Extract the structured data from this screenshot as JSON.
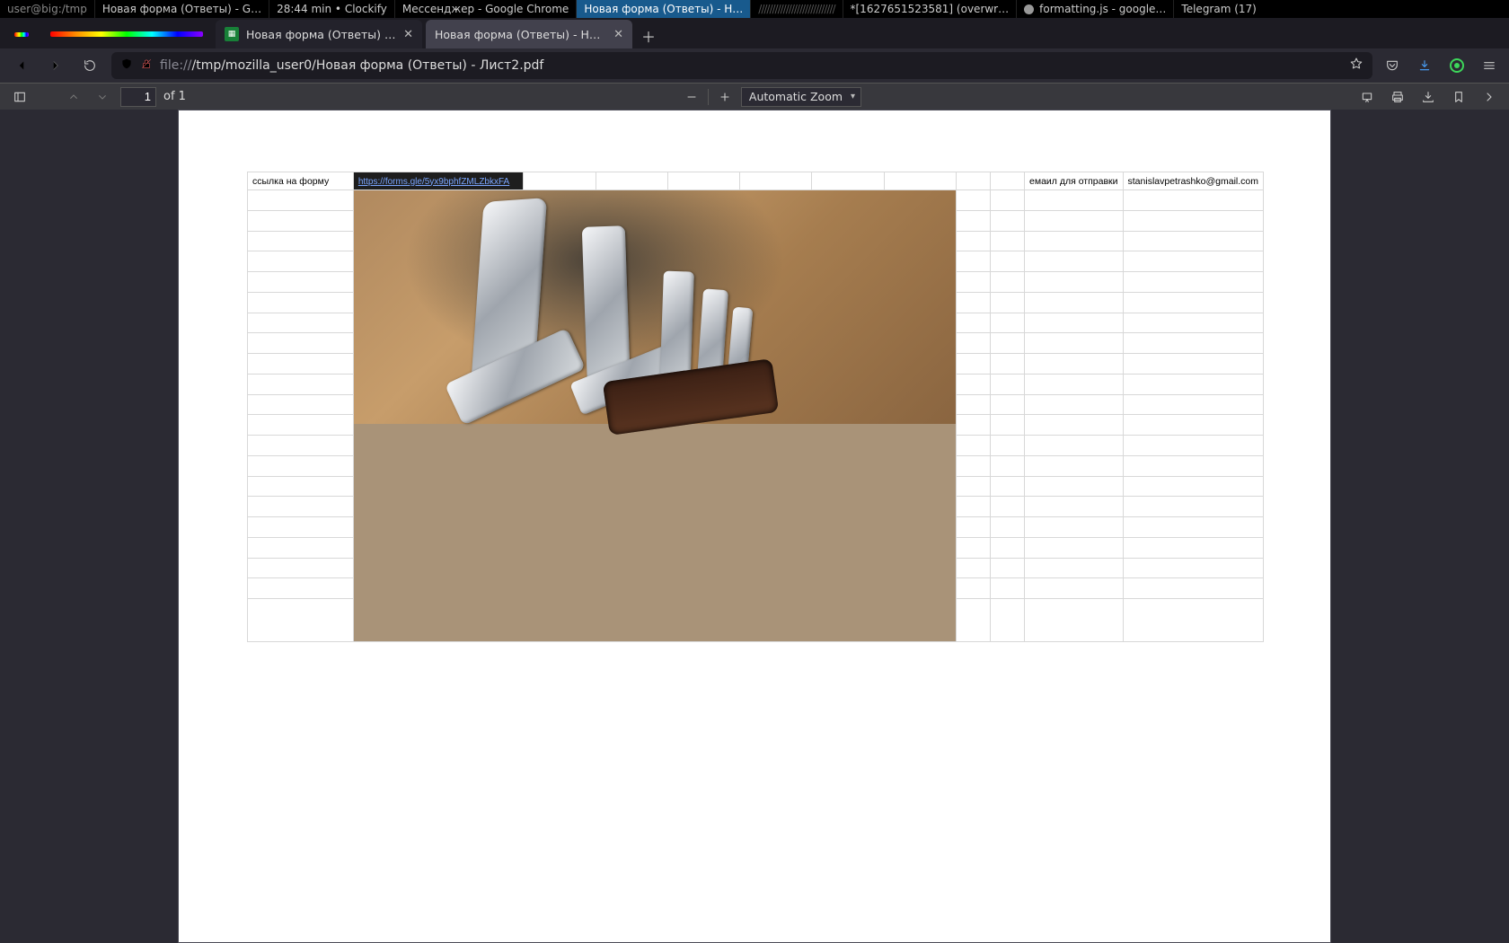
{
  "os_taskbar": {
    "prompt": "user@big:/tmp",
    "items": [
      {
        "label": "Новая форма (Ответы) - G…"
      },
      {
        "label": "28:44 min • Clockify"
      },
      {
        "label": "Мессенджер - Google Chrome"
      },
      {
        "label": "Новая форма (Ответы) - Н…",
        "selected": true
      },
      {
        "label": "*[1627651523581] (overwr…"
      },
      {
        "label": "formatting.js - google…",
        "icon": true
      },
      {
        "label": "Telegram (17)"
      }
    ]
  },
  "browser_tabs": {
    "tab_sheets": "Новая форма (Ответы) - G…",
    "tab_active": "Новая форма (Ответы) - Нова…",
    "url_display": "file:///tmp/mozilla_user0/Новая форма (Ответы) - Лист2.pdf"
  },
  "pdf_toolbar": {
    "page_current": "1",
    "page_of": "of 1",
    "zoom_label": "Automatic Zoom"
  },
  "document": {
    "row1": {
      "label_link": "ссылка на форму",
      "url": "https://forms.gle/5yx9bphfZMLZbkxFA",
      "label_email": "емаил для отправки",
      "email": "stanislavpetrashko@gmail.com"
    }
  }
}
